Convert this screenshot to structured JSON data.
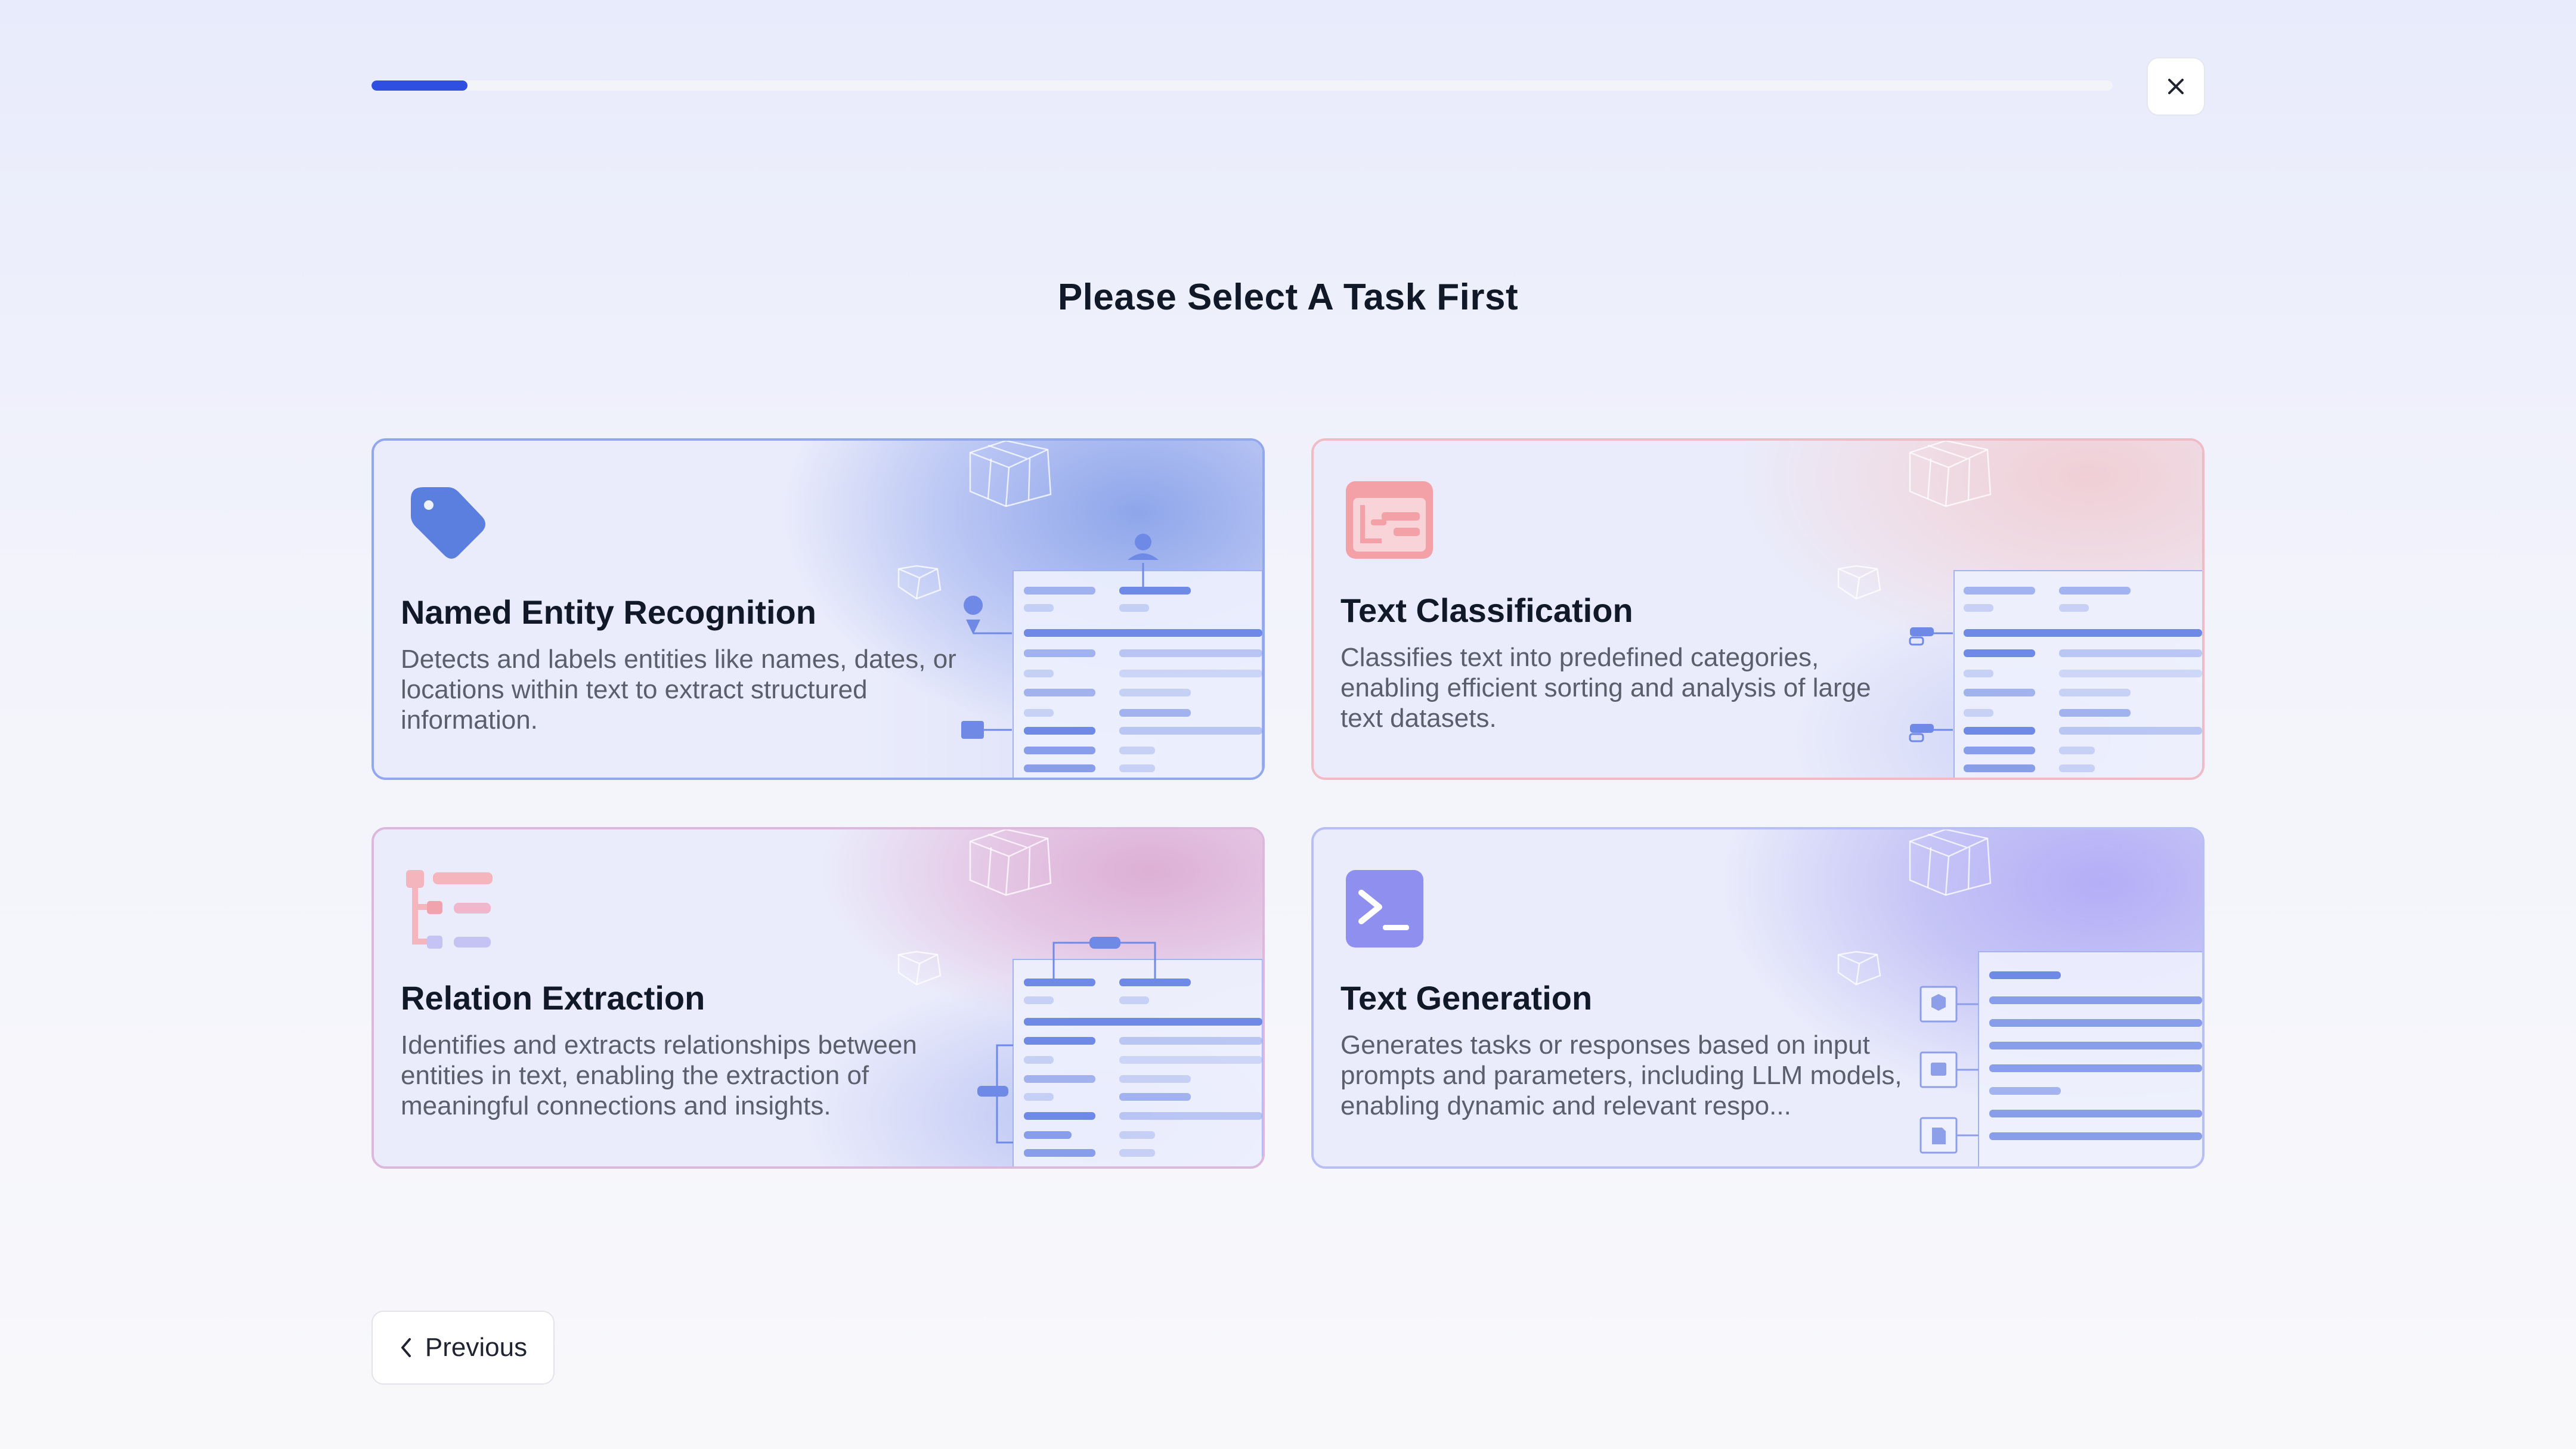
{
  "progress": {
    "value": 0.055
  },
  "header": {
    "close_label": "close"
  },
  "page": {
    "title": "Please Select A Task First"
  },
  "colors": {
    "accent": "#2f4fe0",
    "ner": "#5b7fde",
    "tc": "#ef8f96",
    "re": "#f1a3ad",
    "tg": "#8f8ff0"
  },
  "tasks": [
    {
      "title": "Named Entity Recognition",
      "description": "Detects and labels entities like names, dates, or locations within text to extract structured information.",
      "icon": "tag-icon"
    },
    {
      "title": "Text Classification",
      "description": "Classifies text into predefined categories, enabling efficient sorting and analysis of large text datasets.",
      "icon": "classification-icon"
    },
    {
      "title": "Relation Extraction",
      "description": "Identifies and extracts relationships between entities in text, enabling the extraction of meaningful connections and insights.",
      "icon": "relation-tree-icon"
    },
    {
      "title": "Text Generation",
      "description": "Generates tasks or responses based on input prompts and parameters, including LLM models, enabling dynamic and relevant respo...",
      "icon": "terminal-icon"
    }
  ],
  "footer": {
    "previous_label": "Previous"
  }
}
